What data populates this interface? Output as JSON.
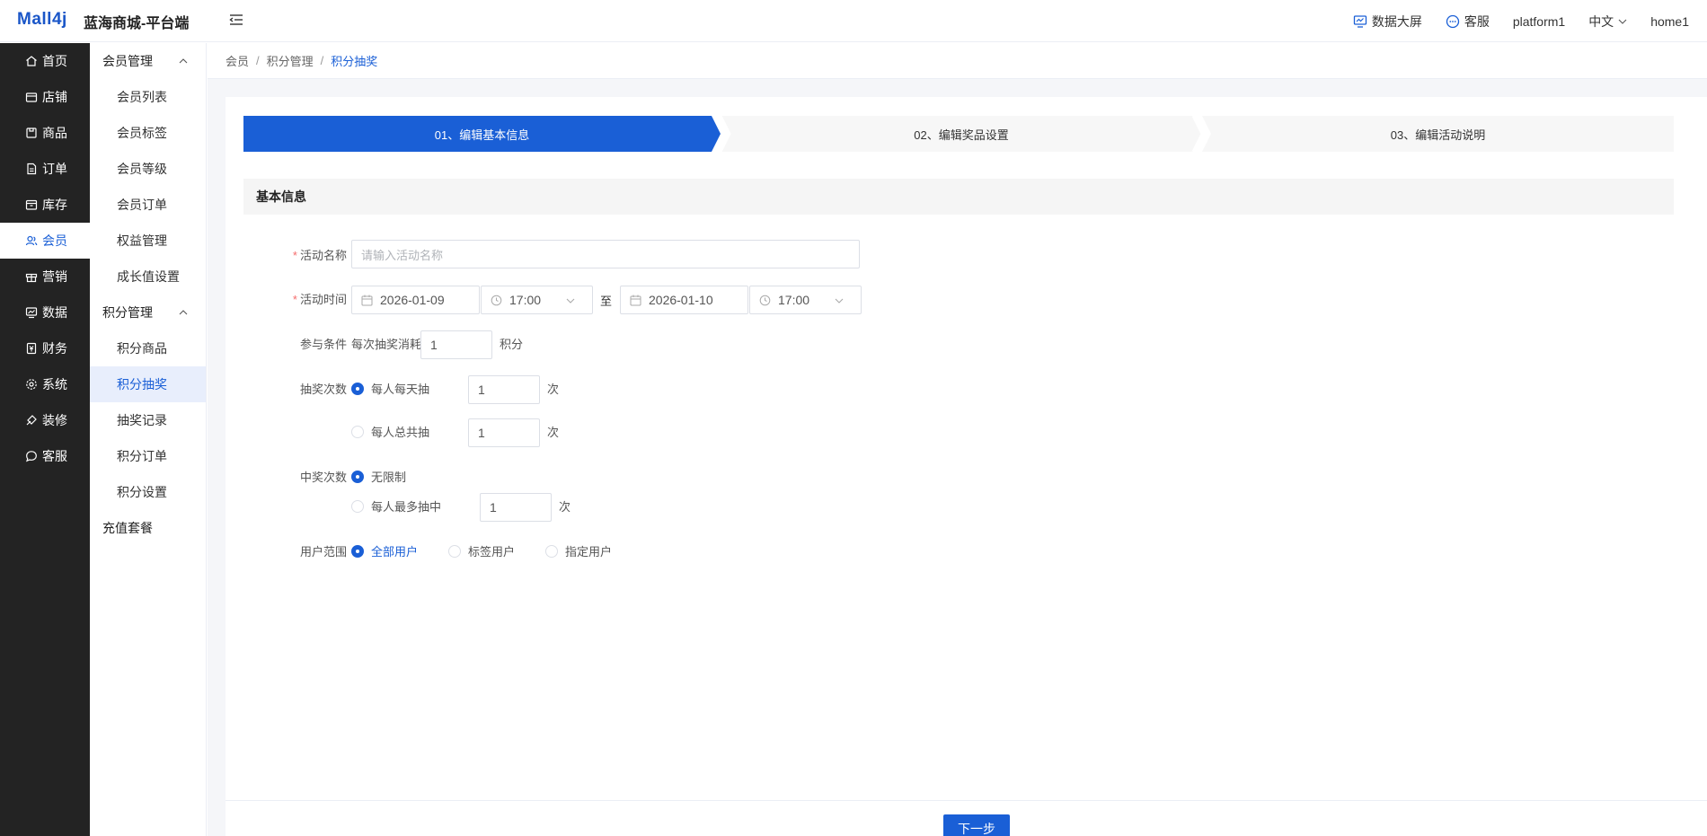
{
  "header": {
    "logo": "Mall4j",
    "brand": "蓝海商城-平台端",
    "data_screen": "数据大屏",
    "service": "客服",
    "user": "platform1",
    "lang": "中文",
    "home": "home1"
  },
  "sidebar": {
    "items": [
      {
        "label": "首页",
        "icon": "home-icon"
      },
      {
        "label": "店铺",
        "icon": "shop-icon"
      },
      {
        "label": "商品",
        "icon": "goods-icon"
      },
      {
        "label": "订单",
        "icon": "order-icon"
      },
      {
        "label": "库存",
        "icon": "stock-icon"
      },
      {
        "label": "会员",
        "icon": "member-icon"
      },
      {
        "label": "营销",
        "icon": "gift-icon"
      },
      {
        "label": "数据",
        "icon": "chart-icon"
      },
      {
        "label": "财务",
        "icon": "finance-icon"
      },
      {
        "label": "系统",
        "icon": "gear-icon"
      },
      {
        "label": "装修",
        "icon": "decorate-icon"
      },
      {
        "label": "客服",
        "icon": "chat-icon"
      }
    ],
    "active_index": 5
  },
  "subnav": {
    "group1": "会员管理",
    "group1_items": [
      "会员列表",
      "会员标签",
      "会员等级",
      "会员订单",
      "权益管理",
      "成长值设置"
    ],
    "group2": "积分管理",
    "group2_items": [
      "积分商品",
      "积分抽奖",
      "抽奖记录",
      "积分订单",
      "积分设置"
    ],
    "extra": "充值套餐"
  },
  "breadcrumb": [
    "会员",
    "积分管理",
    "积分抽奖"
  ],
  "steps": [
    "01、编辑基本信息",
    "02、编辑奖品设置",
    "03、编辑活动说明"
  ],
  "section_title": "基本信息",
  "form": {
    "name_label": "活动名称",
    "name_placeholder": "请输入活动名称",
    "time_label": "活动时间",
    "start_date": "2026-01-09",
    "start_time": "17:00",
    "to": "至",
    "end_date": "2026-01-10",
    "end_time": "17:00",
    "cond_label": "参与条件",
    "cond_prefix": "每次抽奖消耗",
    "cond_value": "1",
    "cond_unit": "积分",
    "draw_label": "抽奖次数",
    "draw_daily": "每人每天抽",
    "draw_daily_value": "1",
    "draw_total": "每人总共抽",
    "draw_total_value": "1",
    "times_unit": "次",
    "win_label": "中奖次数",
    "win_unlimited": "无限制",
    "win_max": "每人最多抽中",
    "win_max_value": "1",
    "scope_label": "用户范围",
    "scope_all": "全部用户",
    "scope_tag": "标签用户",
    "scope_specific": "指定用户"
  },
  "next_button": "下一步",
  "colors": {
    "primary": "#1a5fd6",
    "sidebar_bg": "#232323"
  }
}
